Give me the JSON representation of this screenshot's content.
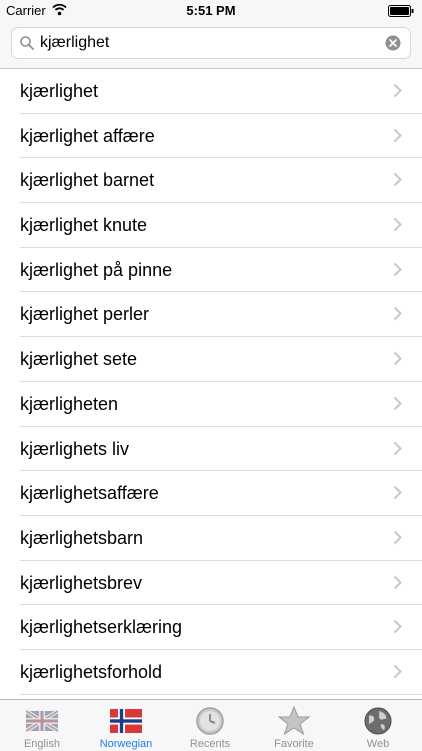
{
  "status_bar": {
    "carrier": "Carrier",
    "time": "5:51 PM"
  },
  "search": {
    "value": "kjærlighet",
    "placeholder": ""
  },
  "results": [
    "kjærlighet",
    "kjærlighet affære",
    "kjærlighet barnet",
    "kjærlighet knute",
    "kjærlighet på pinne",
    "kjærlighet perler",
    "kjærlighet sete",
    "kjærligheten",
    "kjærlighets liv",
    "kjærlighetsaffære",
    "kjærlighetsbarn",
    "kjærlighetsbrev",
    "kjærlighetserklæring",
    "kjærlighetsforhold"
  ],
  "tabs": [
    {
      "label": "English",
      "icon": "uk-flag-icon"
    },
    {
      "label": "Norwegian",
      "icon": "norway-flag-icon",
      "active": true
    },
    {
      "label": "Recents",
      "icon": "clock-icon"
    },
    {
      "label": "Favorite",
      "icon": "star-icon"
    },
    {
      "label": "Web",
      "icon": "globe-icon"
    }
  ],
  "colors": {
    "accent": "#1d7cf2",
    "inactive": "#929292",
    "bar_bg": "#f7f7f7"
  }
}
